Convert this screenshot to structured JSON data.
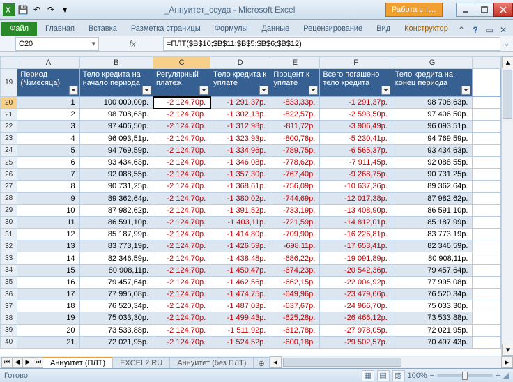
{
  "title": "_Аннуитет_ссуда  -  Microsoft Excel",
  "tool_context": "Работа с т…",
  "ribbon": {
    "file": "Файл",
    "tabs": [
      "Главная",
      "Вставка",
      "Разметка страницы",
      "Формулы",
      "Данные",
      "Рецензирование",
      "Вид",
      "Конструктор"
    ]
  },
  "namebox": "C20",
  "formula": "=ПЛТ($B$10;$B$11;$B$5;$B$6;$B$12)",
  "columns": [
    "A",
    "B",
    "C",
    "D",
    "E",
    "F",
    "G"
  ],
  "headers": {
    "A": "Период (№месяца)",
    "B": "Тело кредита на начало периода",
    "C": "Регулярный платеж",
    "D": "Тело кредита к уплате",
    "E": "Процент к уплате",
    "F": "Всего погашено тело кредита",
    "G": "Тело кредита на конец периода"
  },
  "header_rownum": "19",
  "rows": [
    {
      "n": "20",
      "A": "1",
      "B": "100 000,00р.",
      "C": "-2 124,70р.",
      "D": "-1 291,37р.",
      "E": "-833,33р.",
      "F": "-1 291,37р.",
      "G": "98 708,63р."
    },
    {
      "n": "21",
      "A": "2",
      "B": "98 708,63р.",
      "C": "-2 124,70р.",
      "D": "-1 302,13р.",
      "E": "-822,57р.",
      "F": "-2 593,50р.",
      "G": "97 406,50р."
    },
    {
      "n": "22",
      "A": "3",
      "B": "97 406,50р.",
      "C": "-2 124,70р.",
      "D": "-1 312,98р.",
      "E": "-811,72р.",
      "F": "-3 906,49р.",
      "G": "96 093,51р."
    },
    {
      "n": "23",
      "A": "4",
      "B": "96 093,51р.",
      "C": "-2 124,70р.",
      "D": "-1 323,93р.",
      "E": "-800,78р.",
      "F": "-5 230,41р.",
      "G": "94 769,59р."
    },
    {
      "n": "24",
      "A": "5",
      "B": "94 769,59р.",
      "C": "-2 124,70р.",
      "D": "-1 334,96р.",
      "E": "-789,75р.",
      "F": "-6 565,37р.",
      "G": "93 434,63р."
    },
    {
      "n": "25",
      "A": "6",
      "B": "93 434,63р.",
      "C": "-2 124,70р.",
      "D": "-1 346,08р.",
      "E": "-778,62р.",
      "F": "-7 911,45р.",
      "G": "92 088,55р."
    },
    {
      "n": "26",
      "A": "7",
      "B": "92 088,55р.",
      "C": "-2 124,70р.",
      "D": "-1 357,30р.",
      "E": "-767,40р.",
      "F": "-9 268,75р.",
      "G": "90 731,25р."
    },
    {
      "n": "27",
      "A": "8",
      "B": "90 731,25р.",
      "C": "-2 124,70р.",
      "D": "-1 368,61р.",
      "E": "-756,09р.",
      "F": "-10 637,36р.",
      "G": "89 362,64р."
    },
    {
      "n": "28",
      "A": "9",
      "B": "89 362,64р.",
      "C": "-2 124,70р.",
      "D": "-1 380,02р.",
      "E": "-744,69р.",
      "F": "-12 017,38р.",
      "G": "87 982,62р."
    },
    {
      "n": "29",
      "A": "10",
      "B": "87 982,62р.",
      "C": "-2 124,70р.",
      "D": "-1 391,52р.",
      "E": "-733,19р.",
      "F": "-13 408,90р.",
      "G": "86 591,10р."
    },
    {
      "n": "30",
      "A": "11",
      "B": "86 591,10р.",
      "C": "-2 124,70р.",
      "D": "-1 403,11р.",
      "E": "-721,59р.",
      "F": "-14 812,01р.",
      "G": "85 187,99р."
    },
    {
      "n": "31",
      "A": "12",
      "B": "85 187,99р.",
      "C": "-2 124,70р.",
      "D": "-1 414,80р.",
      "E": "-709,90р.",
      "F": "-16 226,81р.",
      "G": "83 773,19р."
    },
    {
      "n": "32",
      "A": "13",
      "B": "83 773,19р.",
      "C": "-2 124,70р.",
      "D": "-1 426,59р.",
      "E": "-698,11р.",
      "F": "-17 653,41р.",
      "G": "82 346,59р."
    },
    {
      "n": "33",
      "A": "14",
      "B": "82 346,59р.",
      "C": "-2 124,70р.",
      "D": "-1 438,48р.",
      "E": "-686,22р.",
      "F": "-19 091,89р.",
      "G": "80 908,11р."
    },
    {
      "n": "34",
      "A": "15",
      "B": "80 908,11р.",
      "C": "-2 124,70р.",
      "D": "-1 450,47р.",
      "E": "-674,23р.",
      "F": "-20 542,36р.",
      "G": "79 457,64р."
    },
    {
      "n": "35",
      "A": "16",
      "B": "79 457,64р.",
      "C": "-2 124,70р.",
      "D": "-1 462,56р.",
      "E": "-662,15р.",
      "F": "-22 004,92р.",
      "G": "77 995,08р."
    },
    {
      "n": "36",
      "A": "17",
      "B": "77 995,08р.",
      "C": "-2 124,70р.",
      "D": "-1 474,75р.",
      "E": "-649,96р.",
      "F": "-23 479,66р.",
      "G": "76 520,34р."
    },
    {
      "n": "37",
      "A": "18",
      "B": "76 520,34р.",
      "C": "-2 124,70р.",
      "D": "-1 487,03р.",
      "E": "-637,67р.",
      "F": "-24 966,70р.",
      "G": "75 033,30р."
    },
    {
      "n": "38",
      "A": "19",
      "B": "75 033,30р.",
      "C": "-2 124,70р.",
      "D": "-1 499,43р.",
      "E": "-625,28р.",
      "F": "-26 466,12р.",
      "G": "73 533,88р."
    },
    {
      "n": "39",
      "A": "20",
      "B": "73 533,88р.",
      "C": "-2 124,70р.",
      "D": "-1 511,92р.",
      "E": "-612,78р.",
      "F": "-27 978,05р.",
      "G": "72 021,95р."
    },
    {
      "n": "40",
      "A": "21",
      "B": "72 021,95р.",
      "C": "-2 124,70р.",
      "D": "-1 524,52р.",
      "E": "-600,18р.",
      "F": "-29 502,57р.",
      "G": "70 497,43р."
    }
  ],
  "sheets": [
    "Аннуитет (ПЛТ)",
    "EXCEL2.RU",
    "Аннуитет (без ПЛТ)"
  ],
  "active_sheet": 0,
  "status": "Готово",
  "zoom": "100%",
  "chart_data": null
}
